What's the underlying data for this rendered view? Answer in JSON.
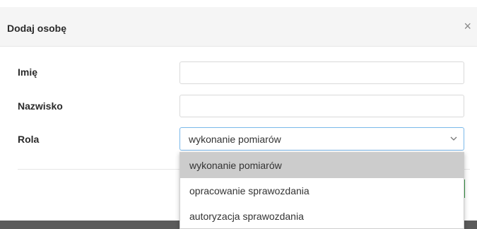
{
  "modal": {
    "title": "Dodaj osobę",
    "close_label": "×"
  },
  "form": {
    "first_name": {
      "label": "Imię",
      "value": "",
      "placeholder": ""
    },
    "last_name": {
      "label": "Nazwisko",
      "value": "",
      "placeholder": ""
    },
    "role": {
      "label": "Rola",
      "selected": "wykonanie pomiarów",
      "options": [
        "wykonanie pomiarów",
        "opracowanie sprawozdania",
        "autoryzacja sprawozdania"
      ],
      "highlighted_index": 0
    }
  },
  "colors": {
    "header_bg": "#f5f5f5",
    "focus_border": "#7ab8ea",
    "highlight_bg": "#cccccc",
    "accent_green": "#3c9c4b"
  }
}
